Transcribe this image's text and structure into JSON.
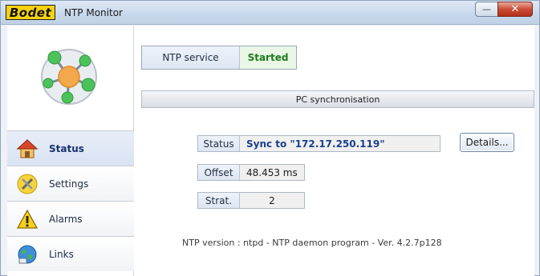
{
  "window": {
    "brand_logo": "Bodet",
    "title": "NTP Monitor",
    "buttons": {
      "minimize": "—",
      "maximize": "□",
      "close": "✕"
    }
  },
  "sidebar": {
    "items": [
      {
        "label": "Status",
        "icon": "home-icon",
        "active": true
      },
      {
        "label": "Settings",
        "icon": "wrench-screwdriver-icon",
        "active": false
      },
      {
        "label": "Alarms",
        "icon": "warning-icon",
        "active": false
      },
      {
        "label": "Links",
        "icon": "globe-icon",
        "active": false
      }
    ]
  },
  "service": {
    "label": "NTP service",
    "value": "Started"
  },
  "sync_panel": {
    "title": "PC synchronisation",
    "status_label": "Status",
    "status_value": "Sync to \"172.17.250.119\"",
    "details_button": "Details...",
    "offset_label": "Offset",
    "offset_value": "48.453 ms",
    "strat_label": "Strat.",
    "strat_value": "2",
    "version_text": "NTP version :  ntpd - NTP daemon program - Ver. 4.2.7p128"
  },
  "colors": {
    "started_text": "#1d7a1d",
    "status_text": "#1b3f8f",
    "logo_yellow": "#f6d10f"
  }
}
